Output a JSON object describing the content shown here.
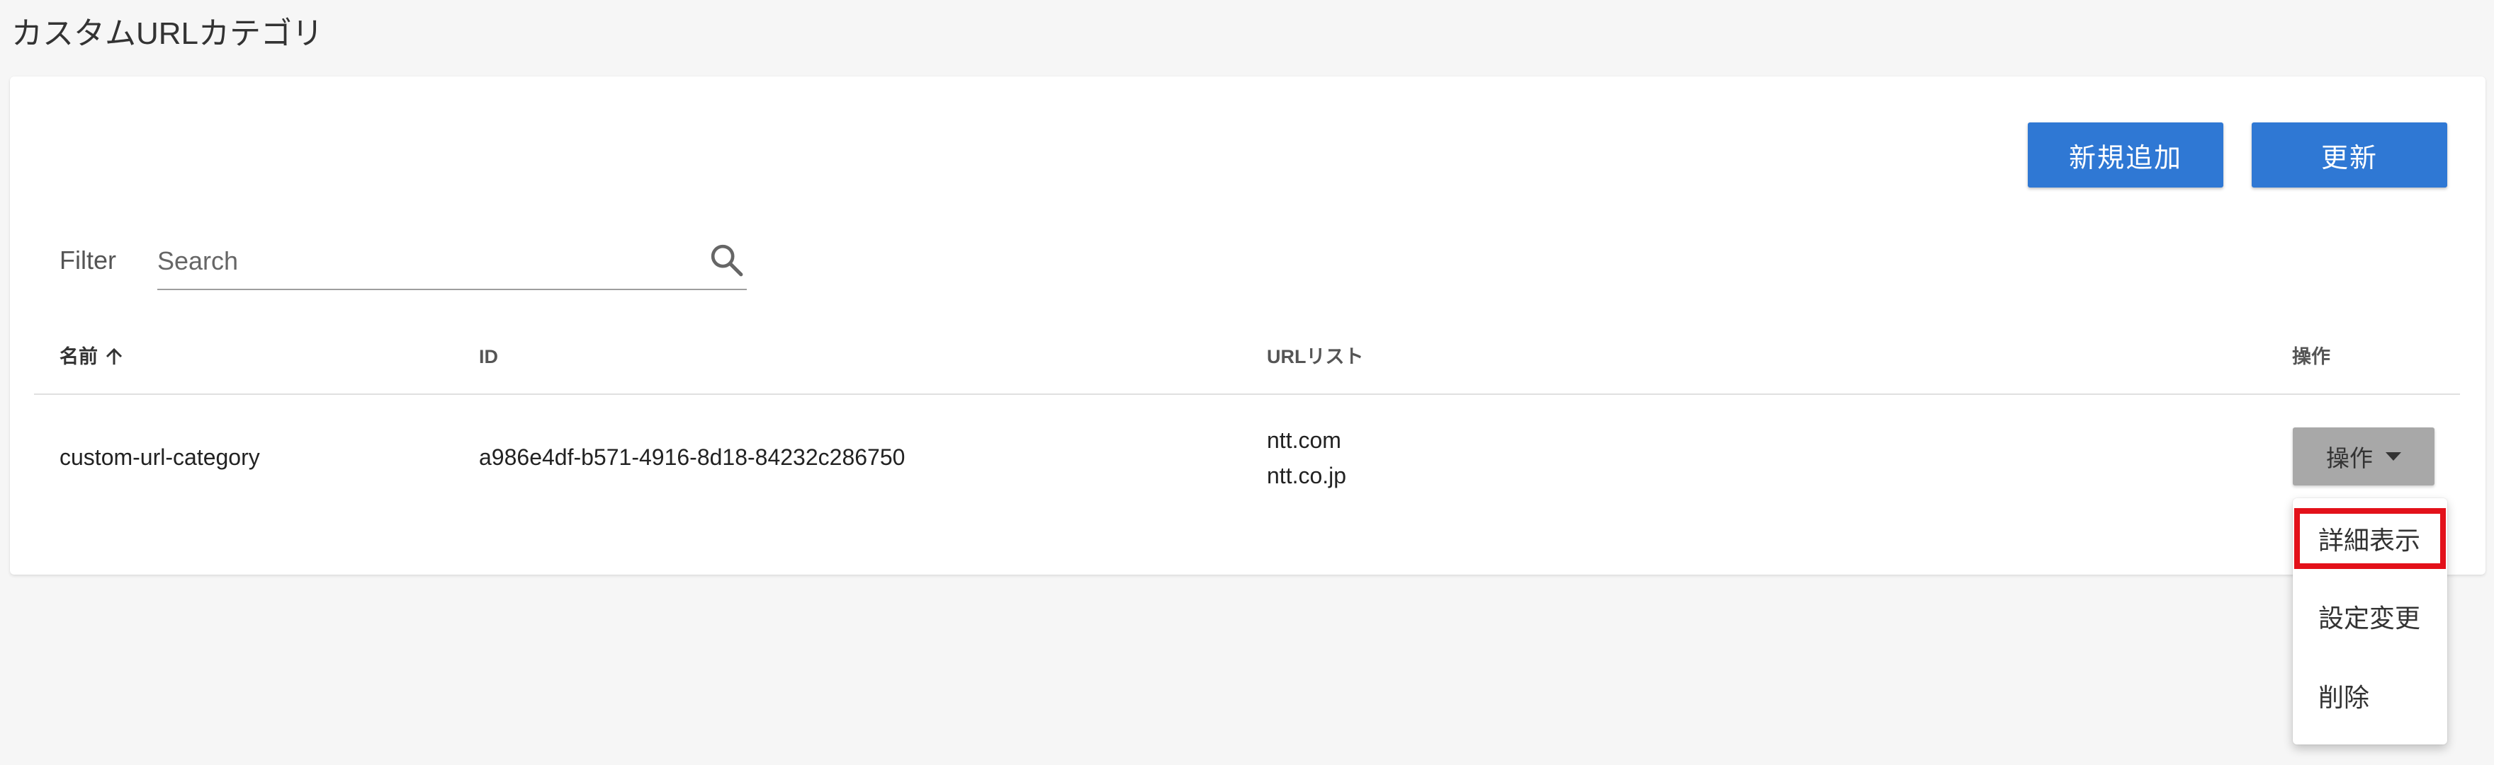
{
  "page": {
    "title": "カスタムURLカテゴリ"
  },
  "toolbar": {
    "new_label": "新規追加",
    "refresh_label": "更新"
  },
  "filter": {
    "label": "Filter",
    "placeholder": "Search",
    "value": ""
  },
  "table": {
    "columns": [
      {
        "label": "名前",
        "sort": "ascending"
      },
      {
        "label": "ID"
      },
      {
        "label": "URLリスト"
      },
      {
        "label": "操作"
      }
    ],
    "rows": [
      {
        "name": "custom-url-category",
        "id": "a986e4df-b571-4916-8d18-84232c286750",
        "urls": [
          "ntt.com",
          "ntt.co.jp"
        ],
        "action_label": "操作"
      }
    ]
  },
  "action_menu": {
    "items": [
      {
        "label": "詳細表示",
        "highlighted": true
      },
      {
        "label": "設定変更"
      },
      {
        "label": "削除"
      }
    ]
  },
  "colors": {
    "primary": "#2f78d4",
    "highlight": "#e3111a",
    "background": "#f6f6f6"
  },
  "icons": {
    "search": "search-icon",
    "sort": "arrow-up-icon",
    "dropdown": "caret-down-icon"
  }
}
